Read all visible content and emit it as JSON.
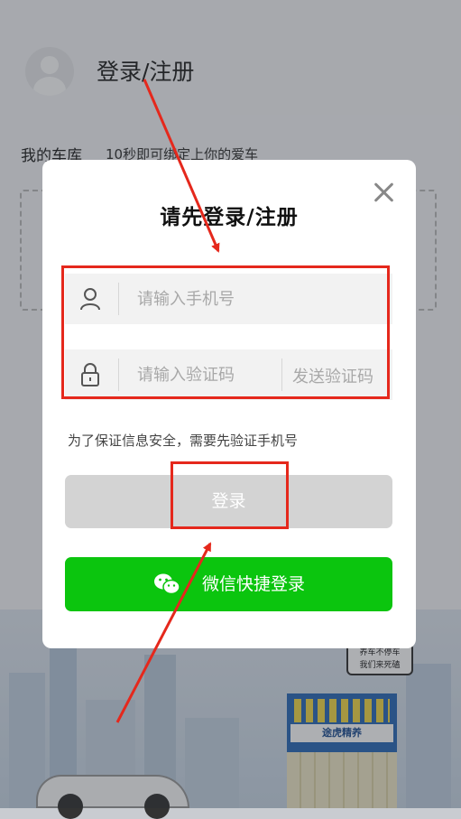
{
  "background": {
    "title": "登录/注册",
    "garage": {
      "title": "我的车库",
      "subtitle": "10秒即可绑定上你的爱车"
    },
    "bubble": {
      "line1": "养车不停车",
      "line2": "我们来死磕"
    },
    "store_sign": "途虎精养"
  },
  "modal": {
    "title": "请先登录/注册",
    "phone_placeholder": "请输入手机号",
    "code_placeholder": "请输入验证码",
    "send_code_label": "发送验证码",
    "notice": "为了保证信息安全，需要先验证手机号",
    "login_label": "登录",
    "wechat_label": "微信快捷登录"
  },
  "colors": {
    "annotation": "#e5281c",
    "wechat_green": "#0bc50e",
    "login_disabled": "#d3d3d3"
  }
}
